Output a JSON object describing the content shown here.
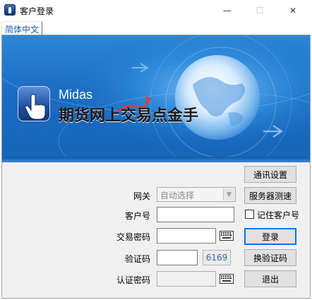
{
  "window": {
    "title": "客户登录",
    "min_glyph": "—",
    "max_glyph": "☐",
    "close_glyph": "✕"
  },
  "tabs": [
    {
      "label": "简体中文",
      "active": true
    }
  ],
  "banner": {
    "brand_en": "Midas",
    "brand_cn": "期货网上交易点金手"
  },
  "form": {
    "gateway_label": "网关",
    "gateway_value": "自动选择",
    "account_label": "客户号",
    "account_value": "",
    "remember_label": "记住客户号",
    "remember_checked": false,
    "trade_password_label": "交易密码",
    "trade_password_value": "",
    "captcha_label": "验证码",
    "captcha_value": "",
    "captcha_code": "6169",
    "auth_password_label": "认证密码",
    "auth_password_value": ""
  },
  "buttons": {
    "comm_settings": "通讯设置",
    "server_speedtest": "服务器测速",
    "login": "登录",
    "refresh_captcha": "换验证码",
    "exit": "退出"
  },
  "icons": {
    "app": "midas-app-icon",
    "keyboard": "soft-keyboard-icon"
  },
  "colors": {
    "banner_blue": "#1b6cc2",
    "tab_text": "#1a5fb4",
    "captcha_text": "#3a6aa8",
    "focus_border": "#0078d7"
  }
}
